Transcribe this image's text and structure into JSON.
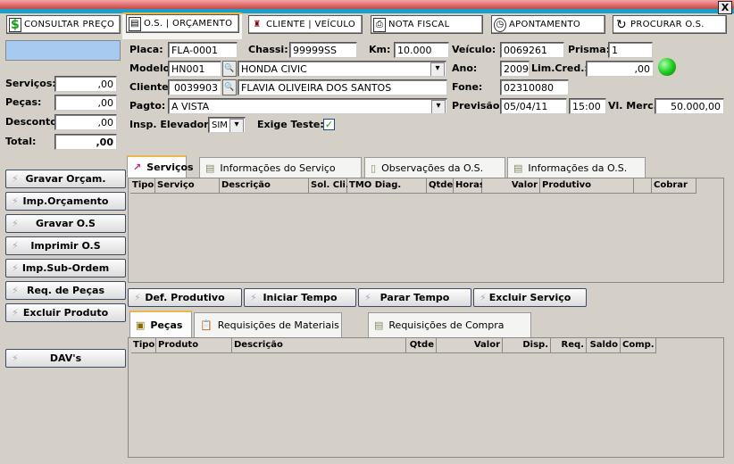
{
  "toolbar": [
    {
      "label": "CONSULTAR PREÇO",
      "icon": "dollar-icon"
    },
    {
      "label": "O.S. | ORÇAMENTO",
      "icon": "document-icon"
    },
    {
      "label": "CLIENTE | VEÍCULO",
      "icon": "car-icon"
    },
    {
      "label": "NOTA FISCAL",
      "icon": "printer-icon"
    },
    {
      "label": "APONTAMENTO",
      "icon": "clock-icon"
    },
    {
      "label": "PROCURAR O.S.",
      "icon": "refresh-icon"
    }
  ],
  "close_label": "X",
  "totals": {
    "servicos_label": "Serviços:",
    "servicos": ",00",
    "pecas_label": "Peças:",
    "pecas": ",00",
    "desconto_label": "Desconto:",
    "desconto": ",00",
    "total_label": "Total:",
    "total": ",00"
  },
  "actions": [
    "Gravar Orçam.",
    "Imp.Orçamento",
    "Gravar O.S",
    "Imprimir O.S",
    "Imp.Sub-Ordem",
    "Req. de Peças",
    "Excluir Produto",
    "DAV's"
  ],
  "form": {
    "placa_label": "Placa:",
    "placa": "FLA-0001",
    "chassi_label": "Chassi:",
    "chassi": "99999SS",
    "km_label": "Km:",
    "km": "10.000",
    "veiculo_label": "Veículo:",
    "veiculo": "0069261",
    "prisma_label": "Prisma:",
    "prisma": "1",
    "modelo_label": "Modelo:",
    "modelo_code": "HN001",
    "modelo": "HONDA CIVIC",
    "ano_label": "Ano:",
    "ano": "2009",
    "limcred_label": "Lim.Cred.:",
    "limcred": ",00",
    "cliente_label": "Cliente:",
    "cliente_code": "0039903",
    "cliente": "FLAVIA OLIVEIRA DOS SANTOS",
    "fone_label": "Fone:",
    "fone": "02310080",
    "pagto_label": "Pagto:",
    "pagto": "A VISTA",
    "previsao_label": "Previsão:",
    "previsao_data": "05/04/11",
    "previsao_hora": "15:00",
    "vlmerc_label": "Vl. Merc.:",
    "vlmerc": "50.000,00",
    "insp_label": "Insp. Elevador:",
    "insp": "SIM",
    "exige_label": "Exige Teste:",
    "exige_checked": true,
    "status_color": "#22cc22"
  },
  "service_tabs": [
    "Serviços",
    "Informações do Serviço",
    "Observações da O.S.",
    "Informações da O.S."
  ],
  "service_columns": [
    "Tipo",
    "Serviço",
    "Descrição",
    "Sol. Cli.",
    "TMO Diag.",
    "Qtde",
    "Horas",
    "Valor",
    "Produtivo",
    "",
    "Cobrar"
  ],
  "service_buttons": [
    "Def. Produtivo",
    "Iniciar Tempo",
    "Parar Tempo",
    "Excluir Serviço"
  ],
  "parts_tabs": [
    "Peças",
    "Requisições de Materiais",
    "Requisições de Compra"
  ],
  "parts_columns": [
    "Tipo",
    "Produto",
    "Descrição",
    "Qtde",
    "Valor",
    "Disp.",
    "Req.",
    "Saldo",
    "Comp."
  ]
}
